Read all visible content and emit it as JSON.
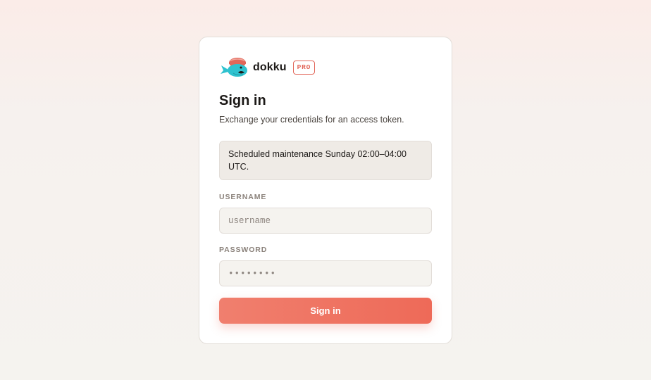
{
  "brand": {
    "name": "dokku",
    "badge": "PRO",
    "logo_icon": "whale-logo-icon"
  },
  "signin": {
    "title": "Sign in",
    "subtitle": "Exchange your credentials for an access token.",
    "notice": "Scheduled maintenance Sunday 02:00–04:00 UTC."
  },
  "form": {
    "username_label": "USERNAME",
    "username_placeholder": "username",
    "password_label": "PASSWORD",
    "password_placeholder": "••••••••",
    "submit_label": "Sign in"
  },
  "colors": {
    "accent": "#ee6a58",
    "logo_body": "#2fc2cf",
    "logo_hat": "#e2675a"
  }
}
